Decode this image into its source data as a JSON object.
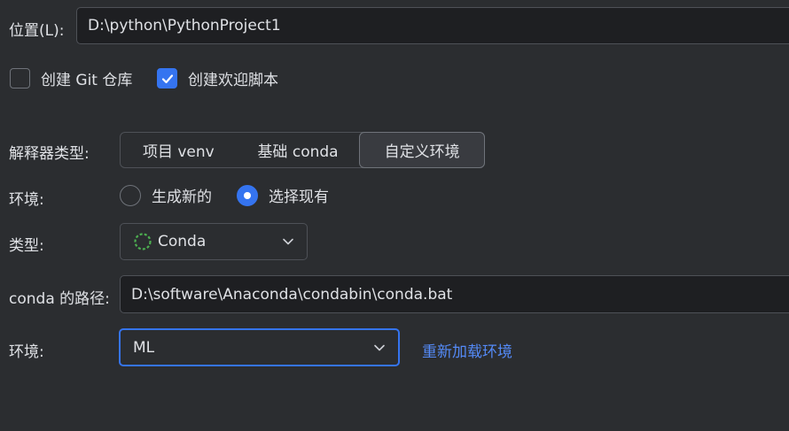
{
  "location": {
    "label": "位置(L):",
    "value": "D:\\python\\PythonProject1"
  },
  "options": {
    "create_git": {
      "label": "创建 Git 仓库",
      "checked": false
    },
    "create_welcome": {
      "label": "创建欢迎脚本",
      "checked": true
    }
  },
  "interpreter": {
    "label": "解释器类型:",
    "tabs": [
      "项目 venv",
      "基础 conda",
      "自定义环境"
    ],
    "selected_tab": "自定义环境"
  },
  "environment": {
    "label": "环境:",
    "options": [
      "生成新的",
      "选择现有"
    ],
    "selected": "选择现有"
  },
  "type": {
    "label": "类型:",
    "value": "Conda",
    "icon": "conda-spinner-icon"
  },
  "conda_path": {
    "label": "conda 的路径:",
    "value": "D:\\software\\Anaconda\\condabin\\conda.bat"
  },
  "env_select": {
    "label": "环境:",
    "value": "ML",
    "reload_link": "重新加载环境"
  },
  "colors": {
    "accent": "#3574f0",
    "link": "#548af7",
    "background": "#2b2d30"
  }
}
